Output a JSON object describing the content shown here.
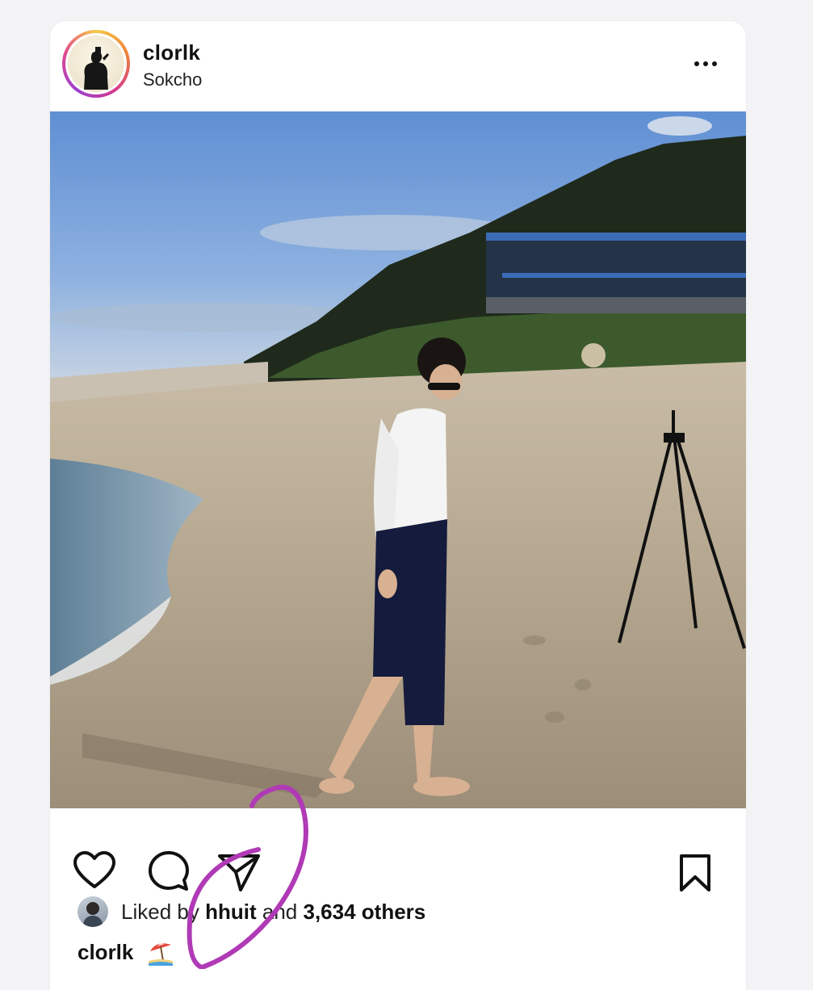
{
  "post": {
    "username": "clorlk",
    "location": "Sokcho",
    "photo_description": "",
    "liked": {
      "prefix": "Liked",
      "by_word": "by",
      "user": "hhuit",
      "and_word": "and",
      "count": "3,634",
      "others_word": "others"
    },
    "caption_username": "clorlk",
    "caption_emoji": "beach-umbrella-icon"
  },
  "colors": {
    "annotation": "#b03ab5",
    "ring_gradient": [
      "#f7c948",
      "#f0813a",
      "#d63a8f",
      "#9b3fd1"
    ]
  }
}
